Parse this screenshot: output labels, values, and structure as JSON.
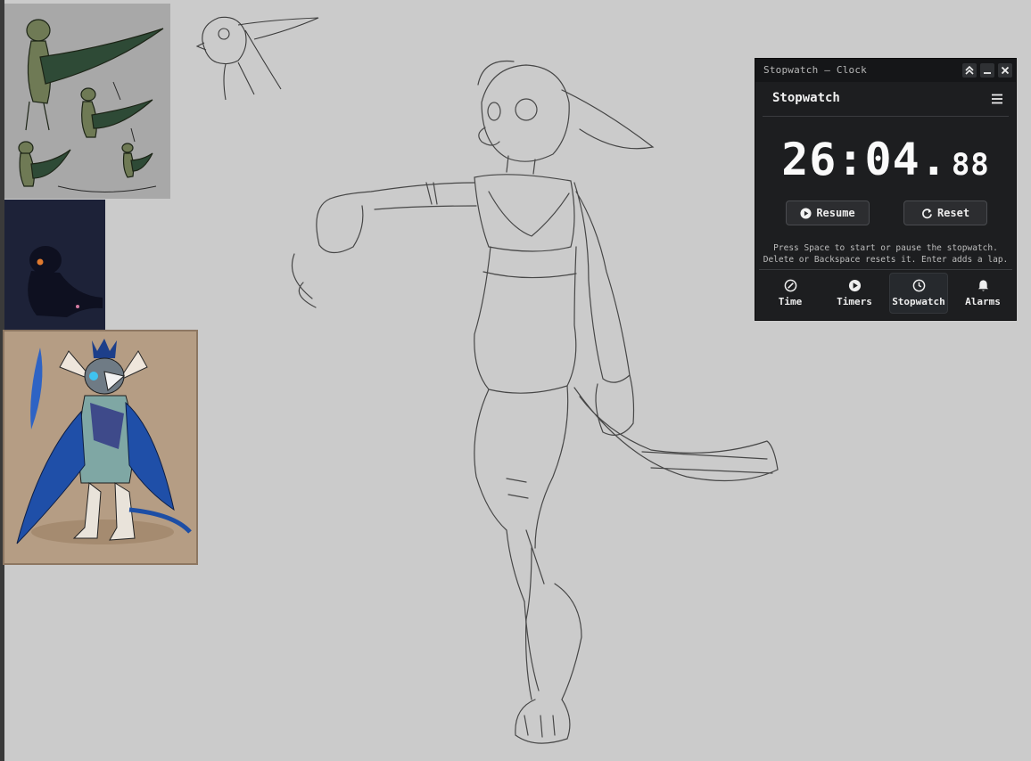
{
  "window": {
    "title": "Stopwatch — Clock",
    "header": "Stopwatch",
    "time_main": "26:04.",
    "time_fraction": "88",
    "buttons": {
      "resume": "Resume",
      "reset": "Reset"
    },
    "hint_line1": "Press Space to start or pause the stopwatch.",
    "hint_line2": "Delete or Backspace resets it. Enter adds a lap.",
    "nav": [
      {
        "label": "Time",
        "icon": "compass-icon"
      },
      {
        "label": "Timers",
        "icon": "play-circle-icon"
      },
      {
        "label": "Stopwatch",
        "icon": "clock-icon"
      },
      {
        "label": "Alarms",
        "icon": "bell-icon"
      }
    ],
    "active_tab": "Stopwatch"
  },
  "colors": {
    "canvas": "#cbcbcb",
    "window_bg": "#1d1e20",
    "accent_text": "#fafafa"
  }
}
